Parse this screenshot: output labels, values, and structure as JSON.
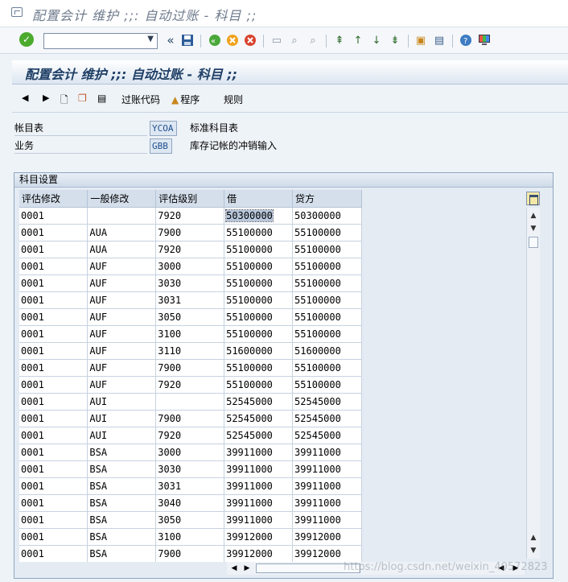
{
  "window": {
    "title": "配置会计 维护 ;;: 自动过账 - 科目 ;;"
  },
  "toolbar": {
    "command_value": ""
  },
  "screen": {
    "title": "配置会计 维护 ;;: 自动过账 - 科目 ;;"
  },
  "app_toolbar": {
    "posting_key_label": "过账代码",
    "procedure_label": "程序",
    "rules_label": "规则"
  },
  "fields": {
    "coa_label": "帐目表",
    "coa_value": "YCOA",
    "coa_desc": "标准科目表",
    "trans_label": "业务",
    "trans_value": "GBB",
    "trans_desc": "库存记帐的冲销输入"
  },
  "group": {
    "title": "科目设置"
  },
  "table": {
    "columns": [
      "评估修改",
      "一般修改",
      "评估级别",
      "借",
      "贷方"
    ],
    "rows": [
      [
        "0001",
        "",
        "7920",
        "50300000",
        "50300000"
      ],
      [
        "0001",
        "AUA",
        "7900",
        "55100000",
        "55100000"
      ],
      [
        "0001",
        "AUA",
        "7920",
        "55100000",
        "55100000"
      ],
      [
        "0001",
        "AUF",
        "3000",
        "55100000",
        "55100000"
      ],
      [
        "0001",
        "AUF",
        "3030",
        "55100000",
        "55100000"
      ],
      [
        "0001",
        "AUF",
        "3031",
        "55100000",
        "55100000"
      ],
      [
        "0001",
        "AUF",
        "3050",
        "55100000",
        "55100000"
      ],
      [
        "0001",
        "AUF",
        "3100",
        "55100000",
        "55100000"
      ],
      [
        "0001",
        "AUF",
        "3110",
        "51600000",
        "51600000"
      ],
      [
        "0001",
        "AUF",
        "7900",
        "55100000",
        "55100000"
      ],
      [
        "0001",
        "AUF",
        "7920",
        "55100000",
        "55100000"
      ],
      [
        "0001",
        "AUI",
        "",
        "52545000",
        "52545000"
      ],
      [
        "0001",
        "AUI",
        "7900",
        "52545000",
        "52545000"
      ],
      [
        "0001",
        "AUI",
        "7920",
        "52545000",
        "52545000"
      ],
      [
        "0001",
        "BSA",
        "3000",
        "39911000",
        "39911000"
      ],
      [
        "0001",
        "BSA",
        "3030",
        "39911000",
        "39911000"
      ],
      [
        "0001",
        "BSA",
        "3031",
        "39911000",
        "39911000"
      ],
      [
        "0001",
        "BSA",
        "3040",
        "39911000",
        "39911000"
      ],
      [
        "0001",
        "BSA",
        "3050",
        "39911000",
        "39911000"
      ],
      [
        "0001",
        "BSA",
        "3100",
        "39912000",
        "39912000"
      ],
      [
        "0001",
        "BSA",
        "7900",
        "39912000",
        "39912000"
      ]
    ]
  },
  "watermark": "https://blog.csdn.net/weixin_40572823"
}
